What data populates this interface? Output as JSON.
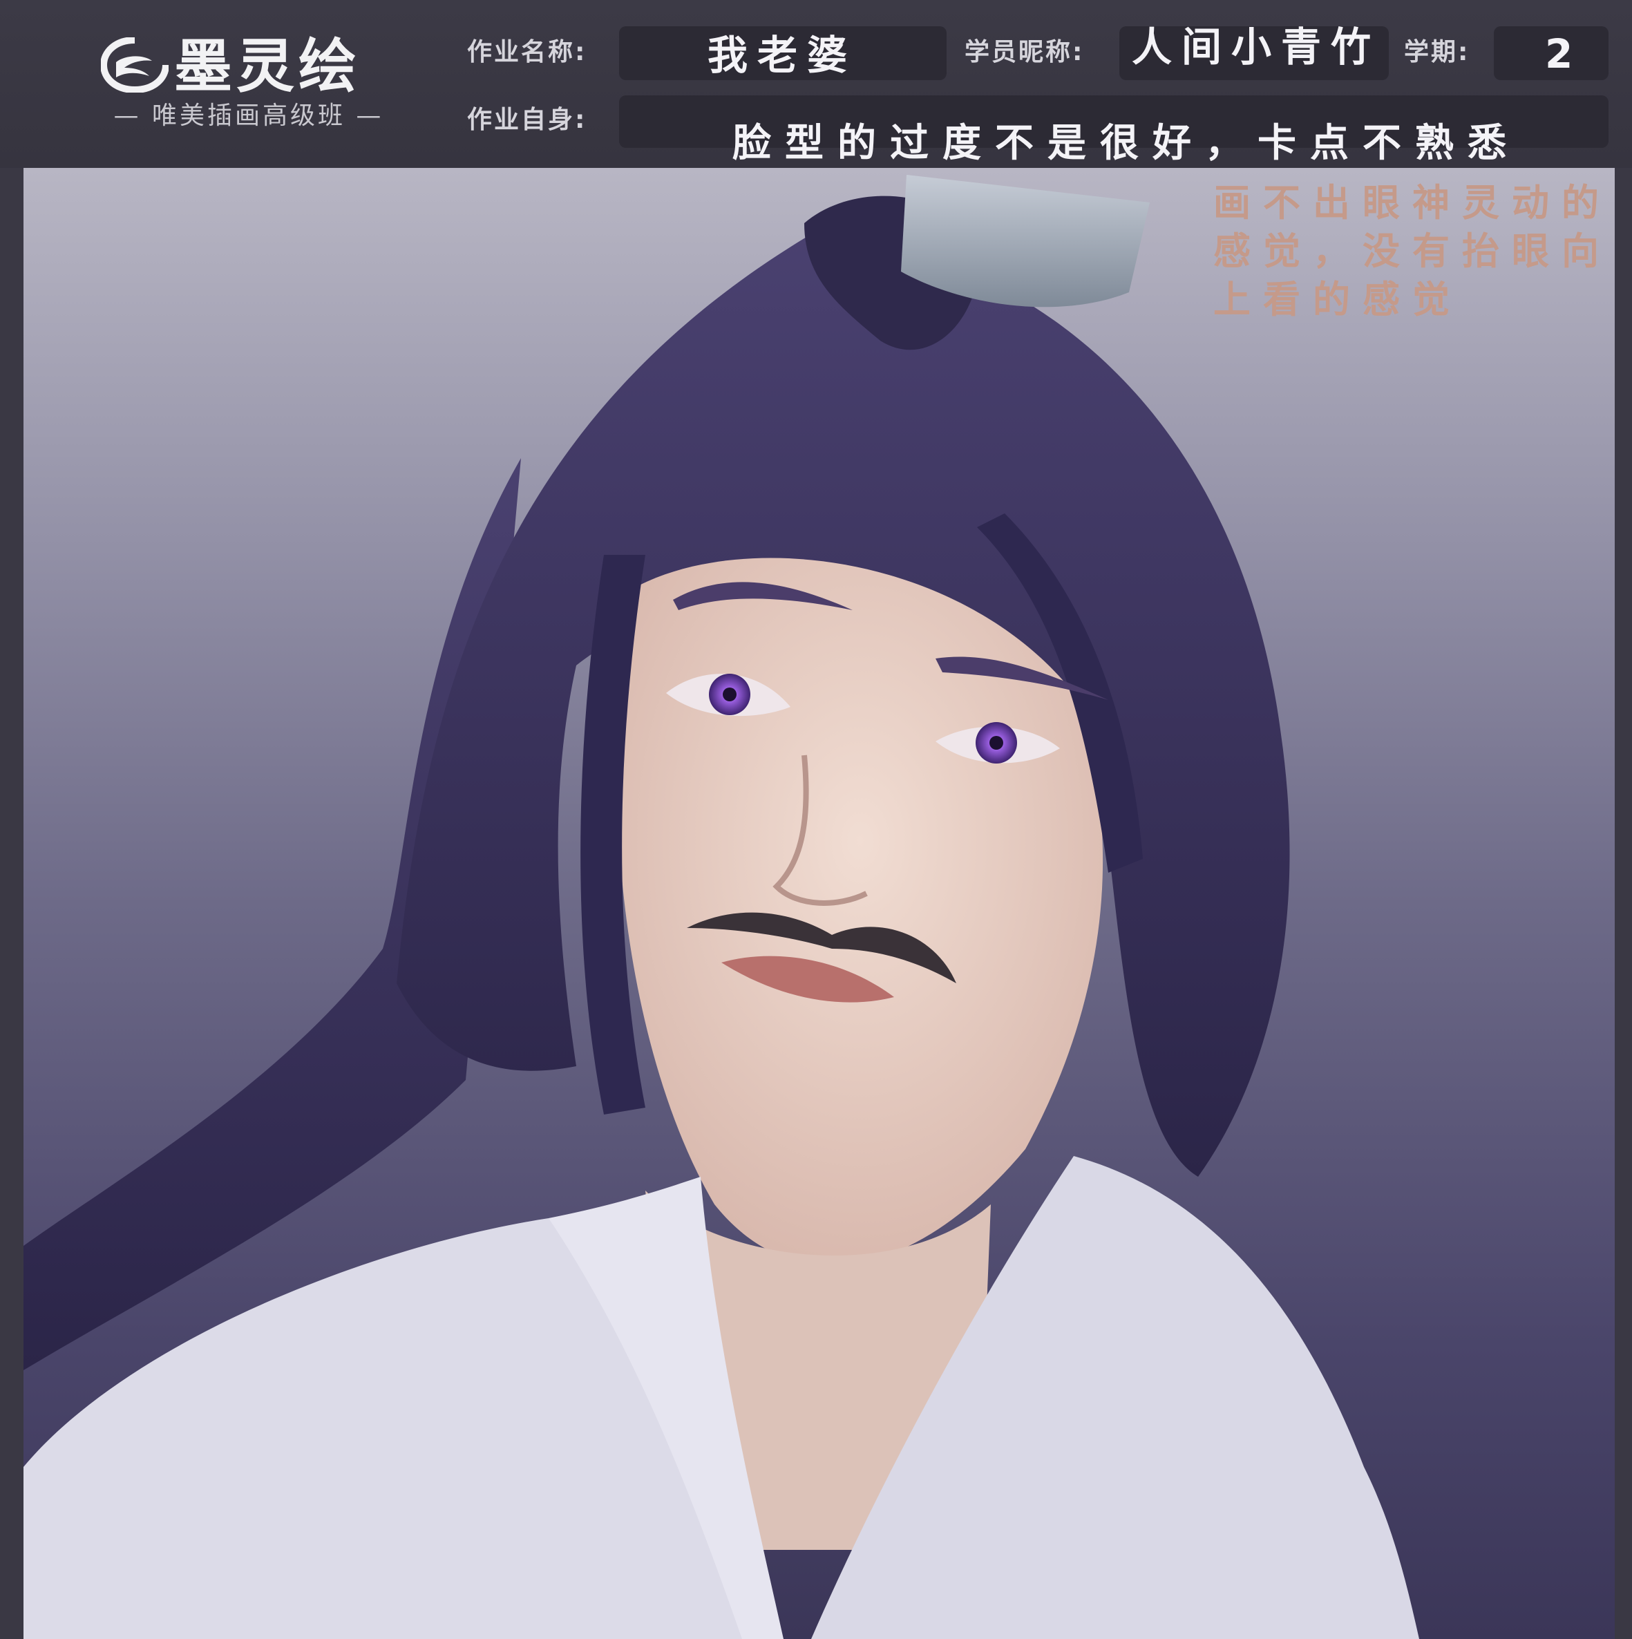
{
  "logo": {
    "brand": "墨灵绘",
    "subtitle": "— 唯美插画高级班 —"
  },
  "form": {
    "work_name_label": "作业名称:",
    "work_name_value": "我老婆",
    "student_label": "学员昵称:",
    "student_value": "人间小青竹",
    "term_label": "学期:",
    "term_value": "2",
    "self_label": "作业自身:",
    "self_value": "脸型的过度不是很好，卡点不熟悉"
  },
  "artwork": {
    "note_lines": [
      "画不出眼神灵动的",
      "感觉，没有抬眼向",
      "上看的感觉"
    ],
    "colors": {
      "hair": "#3a3358",
      "skin": "#e9d2c8",
      "robe": "#dcdbe8",
      "iris": "#8a4fd0",
      "note": "#c59a8a"
    }
  }
}
